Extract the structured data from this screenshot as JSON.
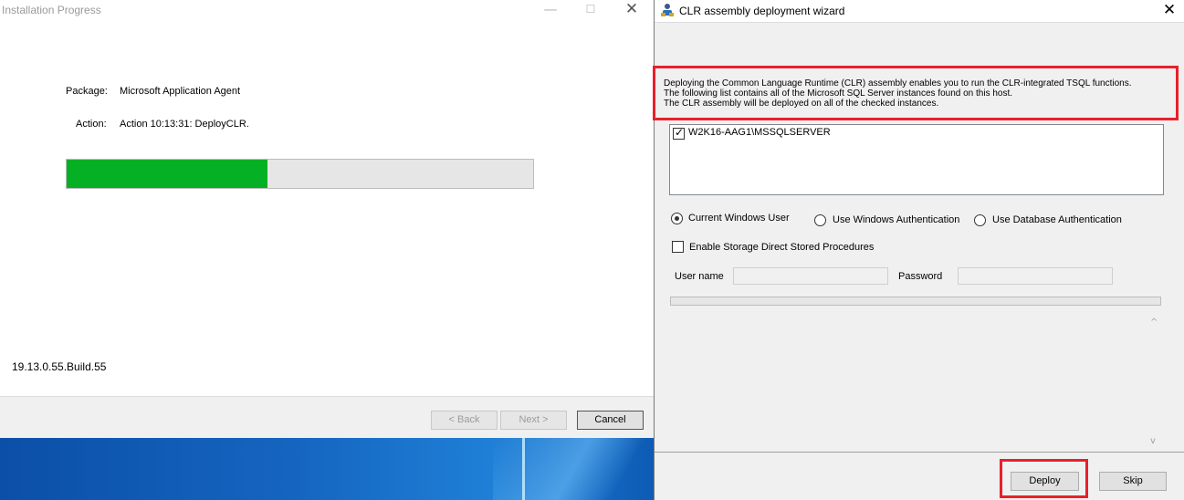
{
  "installer": {
    "title": "Installation Progress",
    "package_label": "Package:",
    "package_value": "Microsoft Application Agent",
    "action_label": "Action:",
    "action_value": "Action 10:13:31: DeployCLR.",
    "progress_fraction": 0.43,
    "version": "19.13.0.55.Build.55",
    "buttons": {
      "back": "< Back",
      "next": "Next >",
      "cancel": "Cancel"
    }
  },
  "wizard": {
    "title": "CLR assembly deployment wizard",
    "close_glyph": "✕",
    "description": [
      "Deploying the Common Language Runtime (CLR) assembly enables you to run the CLR-integrated TSQL functions.",
      "The following list contains all of the Microsoft SQL Server instances found on this host.",
      "The CLR assembly will be deployed on all of the checked instances."
    ],
    "instances": [
      {
        "name": "W2K16-AAG1\\MSSQLSERVER",
        "checked": true
      }
    ],
    "auth_options": {
      "current_user": "Current Windows User",
      "windows_auth": "Use Windows Authentication",
      "db_auth": "Use Database Authentication",
      "selected": "current_user"
    },
    "storage_procs_label": "Enable Storage Direct Stored Procedures",
    "storage_procs_checked": false,
    "user_label": "User name",
    "user_value": "",
    "password_label": "Password",
    "password_value": "",
    "buttons": {
      "deploy": "Deploy",
      "skip": "Skip"
    }
  },
  "colors": {
    "progress_green": "#06b025",
    "highlight_red": "#e8202a"
  }
}
